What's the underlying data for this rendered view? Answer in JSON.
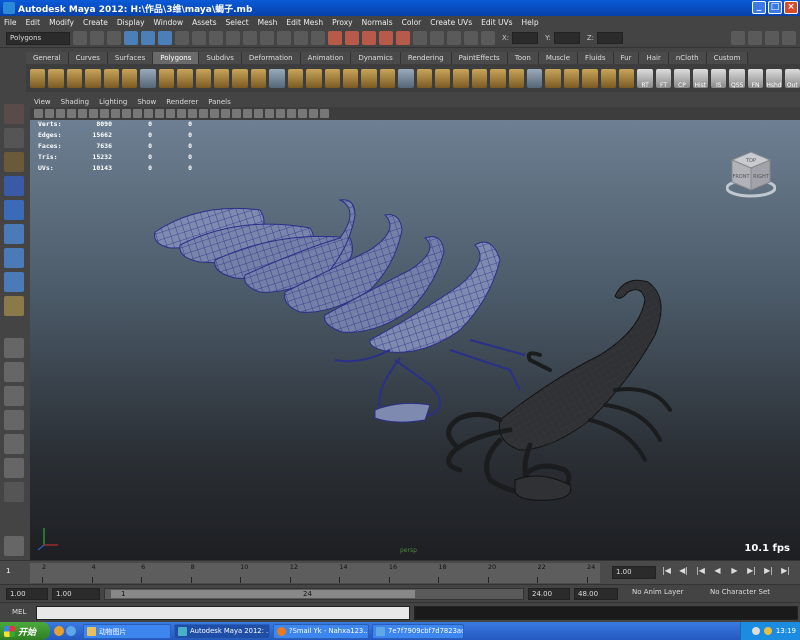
{
  "window": {
    "title": "Autodesk Maya 2012: H:\\作品\\3维\\maya\\蝎子.mb"
  },
  "menus": [
    "File",
    "Edit",
    "Modify",
    "Create",
    "Display",
    "Window",
    "Assets",
    "Select",
    "Mesh",
    "Edit Mesh",
    "Proxy",
    "Normals",
    "Color",
    "Create UVs",
    "Edit UVs",
    "Help"
  ],
  "status": {
    "mode": "Polygons",
    "x_label": "X:",
    "y_label": "Y:",
    "z_label": "Z:"
  },
  "shelf_tabs": [
    "General",
    "Curves",
    "Surfaces",
    "Polygons",
    "Subdivs",
    "Deformation",
    "Animation",
    "Dynamics",
    "Rendering",
    "PaintEffects",
    "Toon",
    "Muscle",
    "Fluids",
    "Fur",
    "Hair",
    "nCloth",
    "Custom"
  ],
  "shelf_active": "Polygons",
  "shelf_labels": [
    "RT",
    "FT",
    "CP",
    "Hist",
    "IS",
    "QSS",
    "FN",
    "Hshd",
    "Out"
  ],
  "panel_menus": [
    "View",
    "Shading",
    "Lighting",
    "Show",
    "Renderer",
    "Panels"
  ],
  "hud": [
    {
      "k": "Verts:",
      "v": "8090",
      "a": "0",
      "b": "0"
    },
    {
      "k": "Edges:",
      "v": "15662",
      "a": "0",
      "b": "0"
    },
    {
      "k": "Faces:",
      "v": "7636",
      "a": "0",
      "b": "0"
    },
    {
      "k": "Tris:",
      "v": "15232",
      "a": "0",
      "b": "0"
    },
    {
      "k": "UVs:",
      "v": "10143",
      "a": "0",
      "b": "0"
    }
  ],
  "viewport": {
    "fps": "10.1 fps",
    "camera": "persp",
    "cube_front": "FRONT",
    "cube_right": "RIGHT",
    "cube_top": "TOP"
  },
  "timeline": {
    "current_frame": "1",
    "ticks": [
      "2",
      "4",
      "6",
      "8",
      "10",
      "12",
      "14",
      "16",
      "18",
      "20",
      "22",
      "24"
    ],
    "current_time": "1.00"
  },
  "range": {
    "start": "1.00",
    "start2": "1.00",
    "bar_start": "1",
    "bar_end": "24",
    "end": "24.00",
    "end2": "48.00",
    "anim_layer": "No Anim Layer",
    "character_set": "No Character Set"
  },
  "cmd": {
    "label": "MEL"
  },
  "taskbar": {
    "start": "开始",
    "tasks": [
      "动物图片",
      "Autodesk Maya 2012: ...",
      "?Smail Yk - Nahxa123...",
      "7e7f7909cbf7d7823ac..."
    ],
    "clock": "13:19"
  }
}
